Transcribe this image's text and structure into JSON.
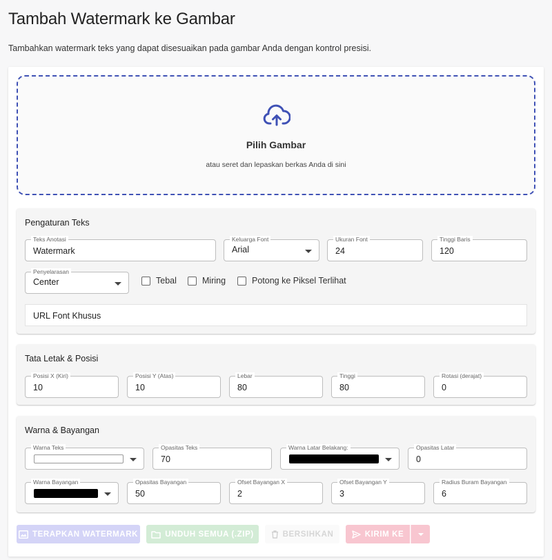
{
  "header": {
    "title": "Tambah Watermark ke Gambar",
    "subtitle": "Tambahkan watermark teks yang dapat disesuaikan pada gambar Anda dengan kontrol presisi."
  },
  "dropzone": {
    "title": "Pilih Gambar",
    "hint": "atau seret dan lepaskan berkas Anda di sini",
    "icon": "cloud-upload-icon"
  },
  "text_settings": {
    "title": "Pengaturan Teks",
    "annotation_text": {
      "label": "Teks Anotasi",
      "value": "Watermark"
    },
    "font_family": {
      "label": "Keluarga Font",
      "value": "Arial"
    },
    "font_size": {
      "label": "Ukuran Font",
      "value": "24"
    },
    "line_height": {
      "label": "Tinggi Baris",
      "value": "120"
    },
    "alignment": {
      "label": "Penyelarasan",
      "value": "Center"
    },
    "bold_label": "Tebal",
    "italic_label": "Miring",
    "crop_label": "Potong ke Piksel Terlihat",
    "custom_font_url": "URL Font Khusus"
  },
  "layout": {
    "title": "Tata Letak & Posisi",
    "pos_x": {
      "label": "Posisi X (Kiri)",
      "value": "10"
    },
    "pos_y": {
      "label": "Posisi Y (Atas)",
      "value": "10"
    },
    "width": {
      "label": "Lebar",
      "value": "80"
    },
    "height": {
      "label": "Tinggi",
      "value": "80"
    },
    "rotation": {
      "label": "Rotasi (derajat)",
      "value": "0"
    }
  },
  "colors": {
    "title": "Warna & Bayangan",
    "text_color": {
      "label": "Warna Teks",
      "color": "#ffffff"
    },
    "text_opacity": {
      "label": "Opasitas Teks",
      "value": "70"
    },
    "bg_color": {
      "label": "Warna Latar Belakang:",
      "color": "#000000"
    },
    "bg_opacity": {
      "label": "Opasitas Latar",
      "value": "0"
    },
    "shadow_color": {
      "label": "Warna Bayangan",
      "color": "#000000"
    },
    "shadow_opacity": {
      "label": "Opasitas Bayangan",
      "value": "50"
    },
    "shadow_offset_x": {
      "label": "Ofset Bayangan X",
      "value": "2"
    },
    "shadow_offset_y": {
      "label": "Ofset Bayangan Y",
      "value": "3"
    },
    "shadow_blur": {
      "label": "Radius Buram Bayangan",
      "value": "6"
    }
  },
  "actions": {
    "apply": "TERAPKAN WATERMARK",
    "download_all": "UNDUH SEMUA (.ZIP)",
    "clear": "BERSIHKAN",
    "send_to": "KIRIM KE"
  },
  "theme": {
    "accent": "#3f51b5",
    "apply_bg": "#d4d4f7",
    "download_bg": "#d3ecd6",
    "send_bg": "#f8c6d0"
  }
}
